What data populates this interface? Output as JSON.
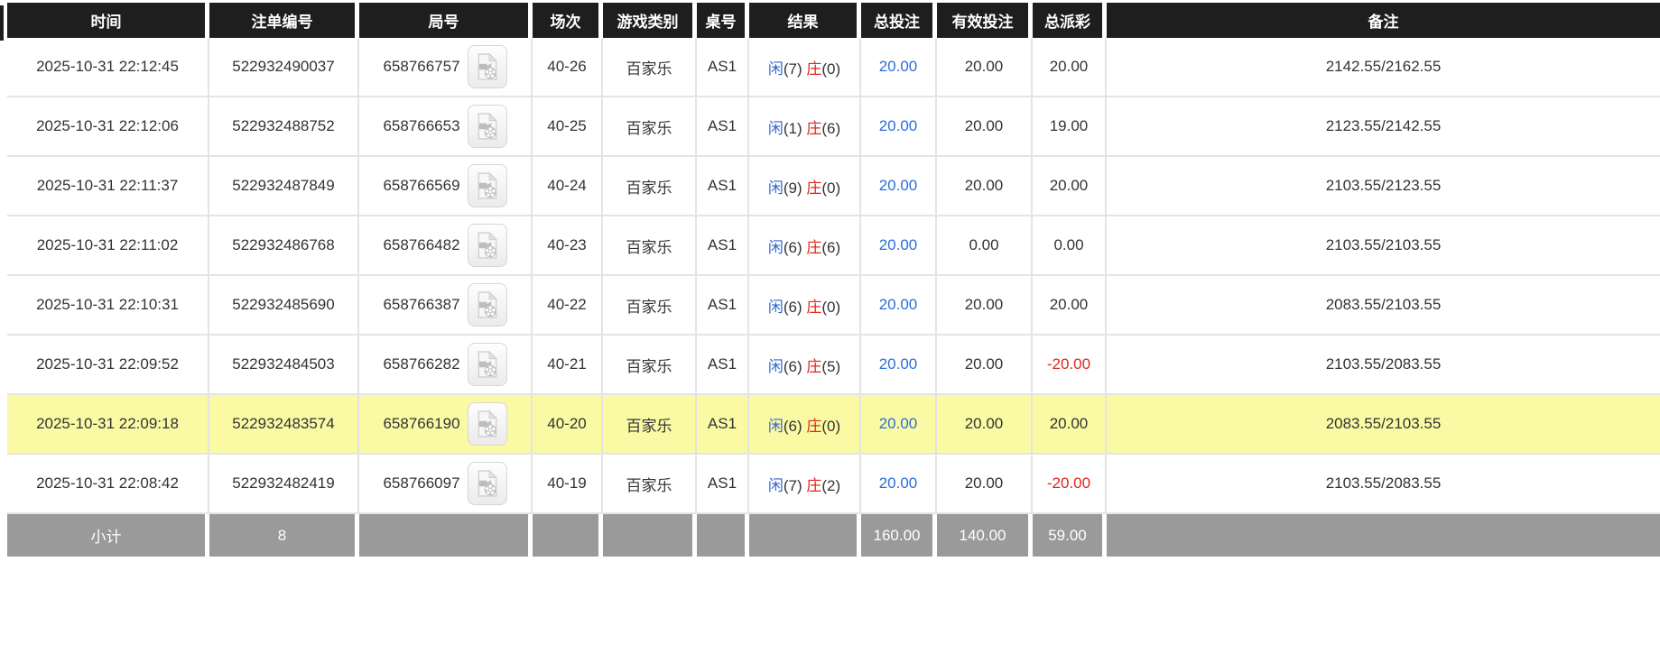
{
  "colors": {
    "header_bg": "#1e1e1e",
    "highlight_row_bg": "#fafaa4",
    "footer_bg": "#9a9a9a",
    "player_blue": "#3366cc",
    "banker_red": "#e0261a",
    "bet_amount_blue": "#2a6ddf",
    "negative_red": "#e0261a",
    "body_text": "#333333"
  },
  "table": {
    "columns": [
      "时间",
      "注单编号",
      "局号",
      "场次",
      "游戏类别",
      "桌号",
      "结果",
      "总投注",
      "有效投注",
      "总派彩",
      "备注"
    ],
    "rows": [
      {
        "time": "2025-10-31 22:12:45",
        "bet_id": "522932490037",
        "round_no": "658766757",
        "session": "40-26",
        "game_type": "百家乐",
        "table_no": "AS1",
        "result_player_label": "闲",
        "result_player_value": "(7)",
        "result_banker_label": "庄",
        "result_banker_value": "(0)",
        "total_bet": "20.00",
        "valid_bet": "20.00",
        "total_payout": "20.00",
        "remark": "2142.55/2162.55",
        "highlighted": false
      },
      {
        "time": "2025-10-31 22:12:06",
        "bet_id": "522932488752",
        "round_no": "658766653",
        "session": "40-25",
        "game_type": "百家乐",
        "table_no": "AS1",
        "result_player_label": "闲",
        "result_player_value": "(1)",
        "result_banker_label": "庄",
        "result_banker_value": "(6)",
        "total_bet": "20.00",
        "valid_bet": "20.00",
        "total_payout": "19.00",
        "remark": "2123.55/2142.55",
        "highlighted": false
      },
      {
        "time": "2025-10-31 22:11:37",
        "bet_id": "522932487849",
        "round_no": "658766569",
        "session": "40-24",
        "game_type": "百家乐",
        "table_no": "AS1",
        "result_player_label": "闲",
        "result_player_value": "(9)",
        "result_banker_label": "庄",
        "result_banker_value": "(0)",
        "total_bet": "20.00",
        "valid_bet": "20.00",
        "total_payout": "20.00",
        "remark": "2103.55/2123.55",
        "highlighted": false
      },
      {
        "time": "2025-10-31 22:11:02",
        "bet_id": "522932486768",
        "round_no": "658766482",
        "session": "40-23",
        "game_type": "百家乐",
        "table_no": "AS1",
        "result_player_label": "闲",
        "result_player_value": "(6)",
        "result_banker_label": "庄",
        "result_banker_value": "(6)",
        "total_bet": "20.00",
        "valid_bet": "0.00",
        "total_payout": "0.00",
        "remark": "2103.55/2103.55",
        "highlighted": false
      },
      {
        "time": "2025-10-31 22:10:31",
        "bet_id": "522932485690",
        "round_no": "658766387",
        "session": "40-22",
        "game_type": "百家乐",
        "table_no": "AS1",
        "result_player_label": "闲",
        "result_player_value": "(6)",
        "result_banker_label": "庄",
        "result_banker_value": "(0)",
        "total_bet": "20.00",
        "valid_bet": "20.00",
        "total_payout": "20.00",
        "remark": "2083.55/2103.55",
        "highlighted": false
      },
      {
        "time": "2025-10-31 22:09:52",
        "bet_id": "522932484503",
        "round_no": "658766282",
        "session": "40-21",
        "game_type": "百家乐",
        "table_no": "AS1",
        "result_player_label": "闲",
        "result_player_value": "(6)",
        "result_banker_label": "庄",
        "result_banker_value": "(5)",
        "total_bet": "20.00",
        "valid_bet": "20.00",
        "total_payout": "-20.00",
        "remark": "2103.55/2083.55",
        "highlighted": false
      },
      {
        "time": "2025-10-31 22:09:18",
        "bet_id": "522932483574",
        "round_no": "658766190",
        "session": "40-20",
        "game_type": "百家乐",
        "table_no": "AS1",
        "result_player_label": "闲",
        "result_player_value": "(6)",
        "result_banker_label": "庄",
        "result_banker_value": "(0)",
        "total_bet": "20.00",
        "valid_bet": "20.00",
        "total_payout": "20.00",
        "remark": "2083.55/2103.55",
        "highlighted": true
      },
      {
        "time": "2025-10-31 22:08:42",
        "bet_id": "522932482419",
        "round_no": "658766097",
        "session": "40-19",
        "game_type": "百家乐",
        "table_no": "AS1",
        "result_player_label": "闲",
        "result_player_value": "(7)",
        "result_banker_label": "庄",
        "result_banker_value": "(2)",
        "total_bet": "20.00",
        "valid_bet": "20.00",
        "total_payout": "-20.00",
        "remark": "2103.55/2083.55",
        "highlighted": false
      }
    ],
    "footer": {
      "label": "小计",
      "count": "8",
      "total_bet": "160.00",
      "valid_bet": "140.00",
      "total_payout": "59.00"
    }
  }
}
